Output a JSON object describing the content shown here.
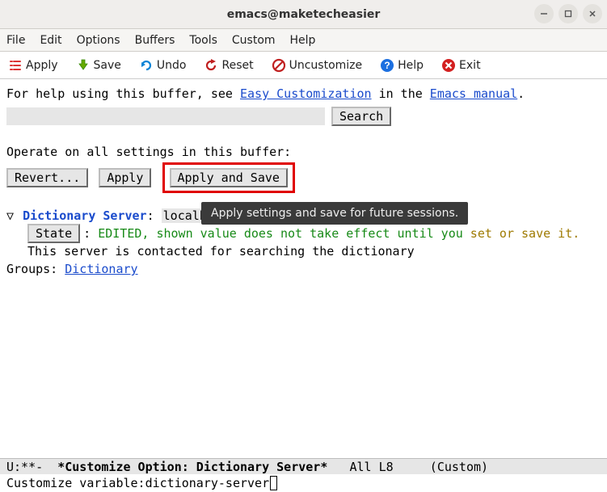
{
  "window": {
    "title": "emacs@maketecheasier"
  },
  "menubar": {
    "items": [
      "File",
      "Edit",
      "Options",
      "Buffers",
      "Tools",
      "Custom",
      "Help"
    ]
  },
  "toolbar": {
    "apply": "Apply",
    "save": "Save",
    "undo": "Undo",
    "reset": "Reset",
    "uncustomize": "Uncustomize",
    "help": "Help",
    "exit": "Exit"
  },
  "help_line": {
    "prefix": "For help using this buffer, see ",
    "link1": "Easy Customization",
    "mid": " in the ",
    "link2": "Emacs manual",
    "suffix": "."
  },
  "search": {
    "value": "",
    "button": "Search"
  },
  "operate_line": "Operate on all settings in this buffer:",
  "buttons": {
    "revert": "Revert...",
    "apply": "Apply",
    "apply_save": "Apply and Save"
  },
  "tooltip": "Apply settings and save for future sessions.",
  "setting": {
    "name": "Dictionary Server",
    "value": "localhost",
    "state_button": "State",
    "state_prefix": "EDITED, shown value does not take effect until you ",
    "state_suffix": "set or save it.",
    "desc": "This server is contacted for searching the dictionary",
    "groups_label": "Groups: ",
    "group_link": "Dictionary"
  },
  "modeline": {
    "left": "U:**- ",
    "bold": " *Customize Option: Dictionary Server*",
    "right": "   All L8     (Custom)"
  },
  "minibuffer": {
    "prompt": "Customize variable: ",
    "value": "dictionary-server"
  }
}
